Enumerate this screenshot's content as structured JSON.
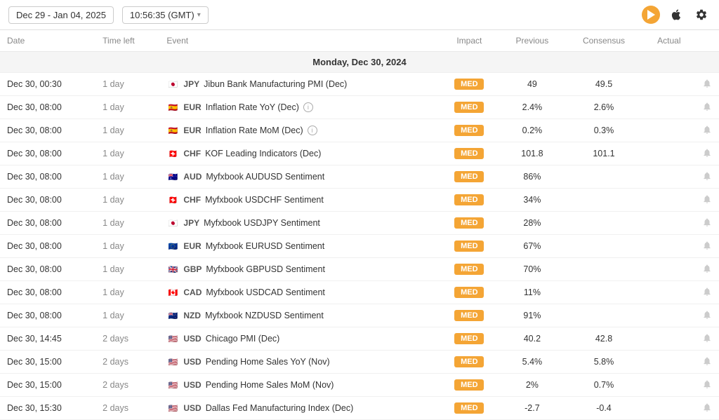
{
  "topbar": {
    "date_range": "Dec 29 - Jan 04, 2025",
    "time": "10:56:35 (GMT)",
    "dropdown_arrow": "▾"
  },
  "columns": {
    "date": "Date",
    "time_left": "Time left",
    "event": "Event",
    "impact": "Impact",
    "previous": "Previous",
    "consensus": "Consensus",
    "actual": "Actual"
  },
  "section_header": "Monday, Dec 30, 2024",
  "rows": [
    {
      "date": "Dec 30, 00:30",
      "time_left": "1 day",
      "flag": "🇯🇵",
      "currency": "JPY",
      "event": "Jibun Bank Manufacturing PMI (Dec)",
      "info": false,
      "impact": "MED",
      "impact_class": "med",
      "previous": "49",
      "consensus": "49.5",
      "actual": ""
    },
    {
      "date": "Dec 30, 08:00",
      "time_left": "1 day",
      "flag": "🇪🇸",
      "currency": "EUR",
      "event": "Inflation Rate YoY (Dec)",
      "info": true,
      "impact": "MED",
      "impact_class": "med",
      "previous": "2.4%",
      "consensus": "2.6%",
      "actual": ""
    },
    {
      "date": "Dec 30, 08:00",
      "time_left": "1 day",
      "flag": "🇪🇸",
      "currency": "EUR",
      "event": "Inflation Rate MoM (Dec)",
      "info": true,
      "impact": "MED",
      "impact_class": "med",
      "previous": "0.2%",
      "consensus": "0.3%",
      "actual": ""
    },
    {
      "date": "Dec 30, 08:00",
      "time_left": "1 day",
      "flag": "🇨🇭",
      "currency": "CHF",
      "event": "KOF Leading Indicators (Dec)",
      "info": false,
      "impact": "MED",
      "impact_class": "med",
      "previous": "101.8",
      "consensus": "101.1",
      "actual": ""
    },
    {
      "date": "Dec 30, 08:00",
      "time_left": "1 day",
      "flag": "🇦🇺",
      "currency": "AUD",
      "event": "Myfxbook AUDUSD Sentiment",
      "info": false,
      "impact": "MED",
      "impact_class": "med",
      "previous": "86%",
      "consensus": "",
      "actual": ""
    },
    {
      "date": "Dec 30, 08:00",
      "time_left": "1 day",
      "flag": "🇨🇭",
      "currency": "CHF",
      "event": "Myfxbook USDCHF Sentiment",
      "info": false,
      "impact": "MED",
      "impact_class": "med",
      "previous": "34%",
      "consensus": "",
      "actual": ""
    },
    {
      "date": "Dec 30, 08:00",
      "time_left": "1 day",
      "flag": "🇯🇵",
      "currency": "JPY",
      "event": "Myfxbook USDJPY Sentiment",
      "info": false,
      "impact": "MED",
      "impact_class": "med",
      "previous": "28%",
      "consensus": "",
      "actual": ""
    },
    {
      "date": "Dec 30, 08:00",
      "time_left": "1 day",
      "flag": "🇪🇺",
      "currency": "EUR",
      "event": "Myfxbook EURUSD Sentiment",
      "info": false,
      "impact": "MED",
      "impact_class": "med",
      "previous": "67%",
      "consensus": "",
      "actual": ""
    },
    {
      "date": "Dec 30, 08:00",
      "time_left": "1 day",
      "flag": "🇬🇧",
      "currency": "GBP",
      "event": "Myfxbook GBPUSD Sentiment",
      "info": false,
      "impact": "MED",
      "impact_class": "med",
      "previous": "70%",
      "consensus": "",
      "actual": ""
    },
    {
      "date": "Dec 30, 08:00",
      "time_left": "1 day",
      "flag": "🇨🇦",
      "currency": "CAD",
      "event": "Myfxbook USDCAD Sentiment",
      "info": false,
      "impact": "MED",
      "impact_class": "med",
      "previous": "11%",
      "consensus": "",
      "actual": ""
    },
    {
      "date": "Dec 30, 08:00",
      "time_left": "1 day",
      "flag": "🇳🇿",
      "currency": "NZD",
      "event": "Myfxbook NZDUSD Sentiment",
      "info": false,
      "impact": "MED",
      "impact_class": "med",
      "previous": "91%",
      "consensus": "",
      "actual": ""
    },
    {
      "date": "Dec 30, 14:45",
      "time_left": "2 days",
      "flag": "🇺🇸",
      "currency": "USD",
      "event": "Chicago PMI (Dec)",
      "info": false,
      "impact": "MED",
      "impact_class": "med",
      "previous": "40.2",
      "consensus": "42.8",
      "actual": ""
    },
    {
      "date": "Dec 30, 15:00",
      "time_left": "2 days",
      "flag": "🇺🇸",
      "currency": "USD",
      "event": "Pending Home Sales YoY (Nov)",
      "info": false,
      "impact": "MED",
      "impact_class": "med",
      "previous": "5.4%",
      "consensus": "5.8%",
      "actual": ""
    },
    {
      "date": "Dec 30, 15:00",
      "time_left": "2 days",
      "flag": "🇺🇸",
      "currency": "USD",
      "event": "Pending Home Sales MoM (Nov)",
      "info": false,
      "impact": "MED",
      "impact_class": "med",
      "previous": "2%",
      "consensus": "0.7%",
      "actual": ""
    },
    {
      "date": "Dec 30, 15:30",
      "time_left": "2 days",
      "flag": "🇺🇸",
      "currency": "USD",
      "event": "Dallas Fed Manufacturing Index (Dec)",
      "info": false,
      "impact": "MED",
      "impact_class": "med",
      "previous": "-2.7",
      "consensus": "-0.4",
      "actual": ""
    }
  ]
}
